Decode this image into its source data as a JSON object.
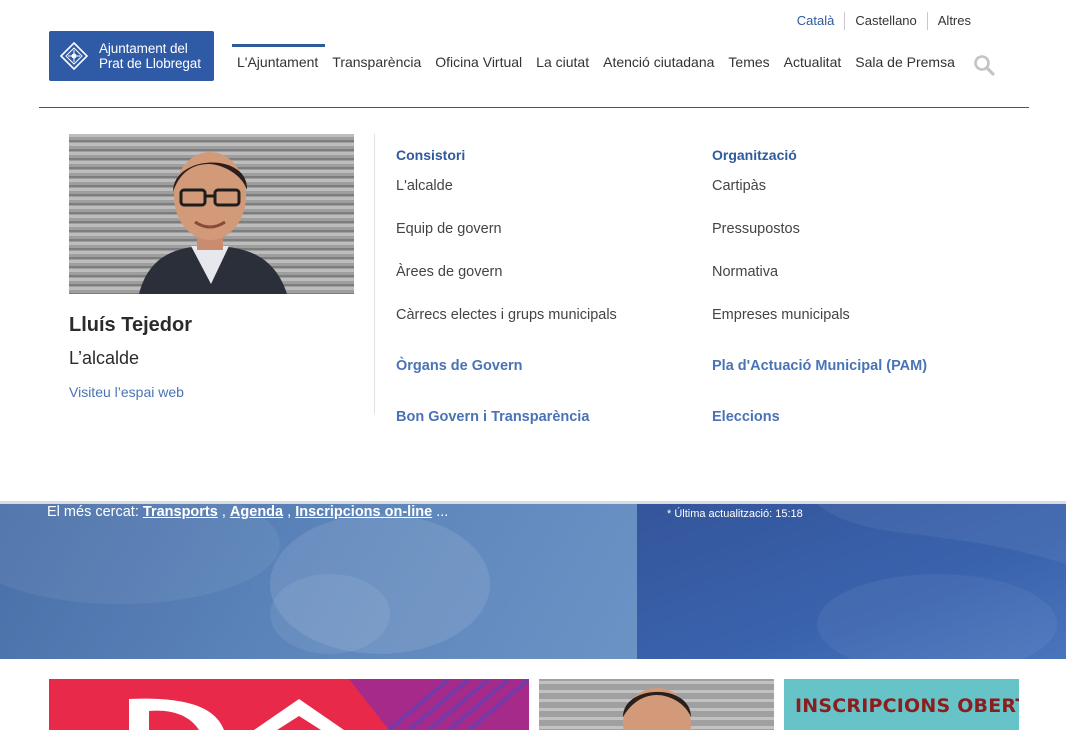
{
  "languages": {
    "catala": "Català",
    "castellano": "Castellano",
    "altres": "Altres"
  },
  "logo": {
    "line1": "Ajuntament del",
    "line2": "Prat de Llobregat"
  },
  "nav": {
    "items": [
      "L'Ajuntament",
      "Transparència",
      "Oficina Virtual",
      "La ciutat",
      "Atenció ciutadana",
      "Temes",
      "Actualitat",
      "Sala de Premsa"
    ]
  },
  "mega": {
    "mayor": {
      "name": "Lluís Tejedor",
      "role": "L’alcalde",
      "link": "Visiteu l’espai web"
    },
    "col1": {
      "heading": "Consistori",
      "links": [
        "L'alcalde",
        "Equip de govern",
        "Àrees de govern",
        "Càrrecs electes i grups municipals"
      ],
      "sections": [
        "Òrgans de Govern",
        "Bon Govern i Transparència"
      ]
    },
    "col2": {
      "heading": "Organització",
      "links": [
        "Cartipàs",
        "Pressupostos",
        "Normativa",
        "Empreses municipals"
      ],
      "sections": [
        "Pla d'Actuació Municipal (PAM)",
        "Eleccions"
      ]
    }
  },
  "banner": {
    "searched_label": "El més cercat:",
    "tags": [
      "Transports",
      "Agenda",
      "Inscripcions on-line"
    ],
    "comma": ",",
    "ellipsis": "...",
    "updated": "* Última actualització: 15:18"
  },
  "cards": {
    "card3_text": "INSCRIPCIONS OBERTES"
  },
  "colors": {
    "brand_blue": "#2f5aa6",
    "link_blue": "#4a73b5",
    "card_red": "#e8294a",
    "card_teal": "#66c4c8"
  }
}
